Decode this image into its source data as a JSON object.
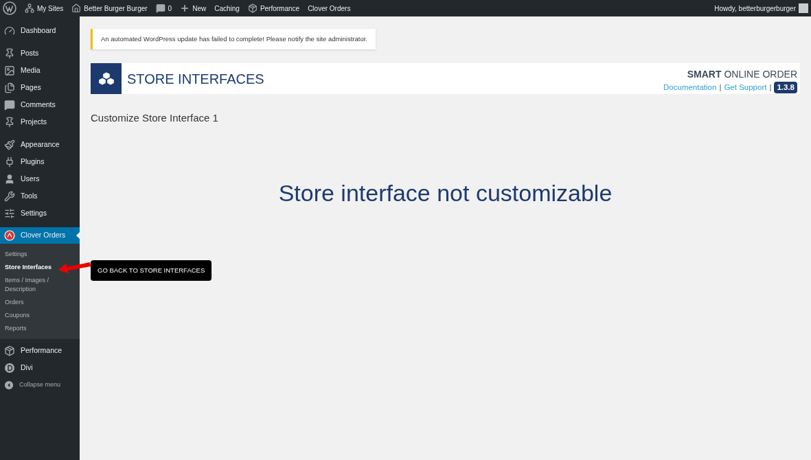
{
  "admin_bar": {
    "left": [
      {
        "kind": "wordpress"
      },
      {
        "kind": "sites",
        "label": "My Sites"
      },
      {
        "kind": "home",
        "label": "Better Burger Burger"
      },
      {
        "kind": "comment",
        "label": "0"
      },
      {
        "kind": "plus",
        "label": "New"
      },
      {
        "label": "Caching"
      },
      {
        "kind": "box",
        "label": "Performance"
      },
      {
        "label": "Clover Orders"
      }
    ],
    "greeting": "Howdy, betterburgerburger"
  },
  "sidebar": {
    "groups": [
      [
        {
          "kind": "dashboard",
          "label": "Dashboard",
          "selected": false
        }
      ],
      [
        {
          "kind": "pin",
          "label": "Posts",
          "selected": false
        },
        {
          "kind": "media",
          "label": "Media",
          "selected": false
        },
        {
          "kind": "pages",
          "label": "Pages",
          "selected": false
        },
        {
          "kind": "comment",
          "label": "Comments",
          "selected": false
        },
        {
          "kind": "pin",
          "label": "Projects",
          "selected": false
        }
      ],
      [
        {
          "kind": "brush",
          "label": "Appearance",
          "selected": false
        },
        {
          "kind": "plug",
          "label": "Plugins",
          "selected": false
        },
        {
          "kind": "user",
          "label": "Users",
          "selected": false
        },
        {
          "kind": "wrench",
          "label": "Tools",
          "selected": false
        },
        {
          "kind": "settings",
          "label": "Settings",
          "selected": false
        }
      ],
      [
        {
          "kind": "clover",
          "label": "Clover Orders",
          "selected": true,
          "children": [
            {
              "label": "Settings",
              "selected": false
            },
            {
              "label": "Store Interfaces",
              "selected": true
            },
            {
              "label": "Items / Images / Description",
              "selected": false
            },
            {
              "label": "Orders",
              "selected": false
            },
            {
              "label": "Coupons",
              "selected": false
            },
            {
              "label": "Reports",
              "selected": false
            }
          ]
        },
        {
          "kind": "box",
          "label": "Performance",
          "selected": false
        },
        {
          "kind": "divi",
          "label": "Divi",
          "selected": false
        },
        {
          "kind": "collapse",
          "label": "Collapse menu",
          "selected": false
        }
      ]
    ]
  },
  "notice": "An automated WordPress update has failed to complete! Please notify the site administrator.",
  "header": {
    "title": "STORE INTERFACES",
    "brand_bold": "SMART",
    "brand_rest": "ONLINE ORDER",
    "links": [
      "Documentation",
      "Get Support"
    ],
    "separator": "|",
    "version": "1.3.8"
  },
  "subtitle": "Customize Store Interface 1",
  "message": "Store interface not customizable",
  "back_button": "GO BACK TO STORE INTERFACES"
}
